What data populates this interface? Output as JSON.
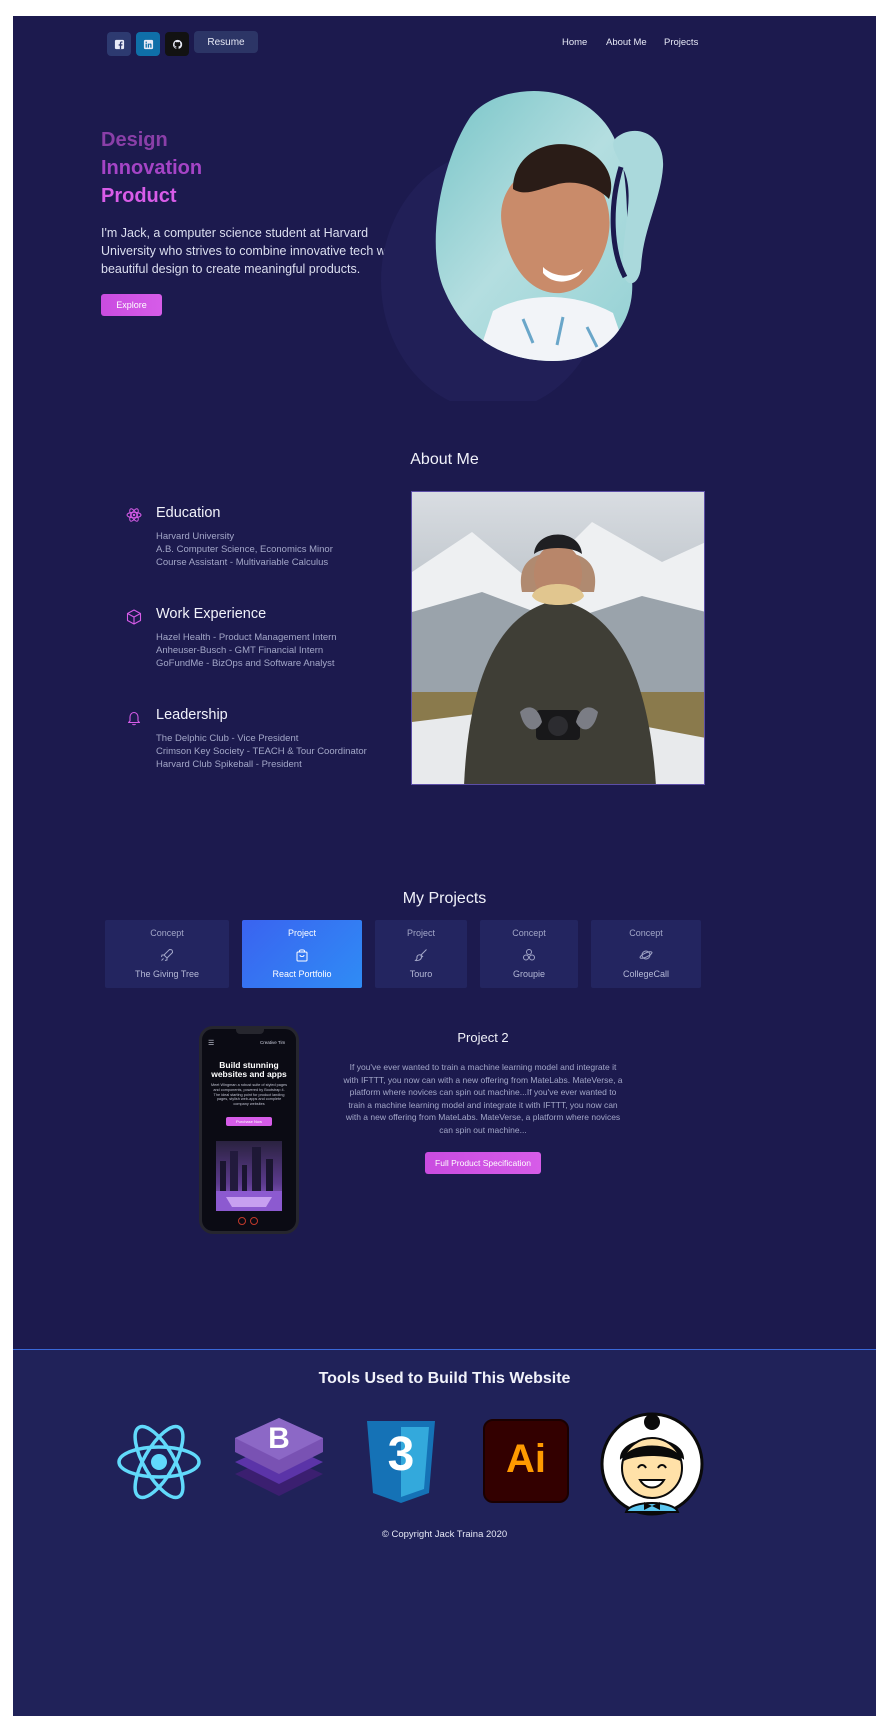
{
  "nav": {
    "resume_label": "Resume",
    "links": [
      "Home",
      "About Me",
      "Projects"
    ],
    "socials": [
      "facebook-icon",
      "linkedin-icon",
      "github-icon"
    ]
  },
  "hero": {
    "words": [
      "Design",
      "Innovation",
      "Product"
    ],
    "intro": "I'm Jack, a computer science student at Harvard University who strives to combine innovative tech with beautiful design to create meaningful products.",
    "explore_label": "Explore"
  },
  "about": {
    "title": "About Me",
    "sections": [
      {
        "icon": "atom-icon",
        "heading": "Education",
        "lines": [
          "Harvard University",
          "A.B. Computer Science, Economics Minor",
          "Course Assistant - Multivariable Calculus"
        ]
      },
      {
        "icon": "cube-icon",
        "heading": "Work Experience",
        "lines": [
          "Hazel Health - Product Management Intern",
          "Anheuser-Busch - GMT Financial Intern",
          "GoFundMe - BizOps and Software Analyst"
        ]
      },
      {
        "icon": "bell-icon",
        "heading": "Leadership",
        "lines": [
          "The Delphic Club - Vice President",
          "Crimson Key Society - TEACH & Tour Coordinator",
          "Harvard Club Spikeball - President"
        ]
      }
    ]
  },
  "projects": {
    "title": "My Projects",
    "cards": [
      {
        "type": "Concept",
        "name": "The Giving Tree",
        "icon": "rocket-icon",
        "active": false
      },
      {
        "type": "Project",
        "name": "React Portfolio",
        "icon": "bag-icon",
        "active": true
      },
      {
        "type": "Project",
        "name": "Touro",
        "icon": "brush-icon",
        "active": false
      },
      {
        "type": "Concept",
        "name": "Groupie",
        "icon": "circles-icon",
        "active": false
      },
      {
        "type": "Concept",
        "name": "CollegeCall",
        "icon": "planet-icon",
        "active": false
      }
    ],
    "detail": {
      "title": "Project 2",
      "description": "If you've ever wanted to train a machine learning model and integrate it with IFTTT, you now can with a new offering from MateLabs. MateVerse, a platform where novices can spin out machine...If you've ever wanted to train a machine learning model and integrate it with IFTTT, you now can with a new offering from MateLabs. MateVerse, a platform where novices can spin out machine...",
      "button_label": "Full Product Specification"
    },
    "phone": {
      "brand": "Creative Tim",
      "headline": "Build stunning websites and apps",
      "body": "Meet Wingman a robust suite of styled pages and components, powered by Bootstrap 4. The ideal starting point for product landing pages, stylish web-apps and complete company websites",
      "button": "Purchase Now"
    }
  },
  "footer": {
    "tools_title": "Tools Used to Build This Website",
    "tools": [
      {
        "icon": "react-icon",
        "label": ""
      },
      {
        "icon": "bootstrap-icon",
        "label": "B"
      },
      {
        "icon": "css3-icon",
        "label": "3"
      },
      {
        "icon": "illustrator-icon",
        "label": "Ai"
      },
      {
        "icon": "avatar-icon",
        "label": ""
      }
    ],
    "copyright": "© Copyright Jack Traina 2020"
  },
  "colors": {
    "background": "#1c1a4e",
    "accent_pink": "#d65ce8",
    "accent_blue": "#2f7ff5"
  }
}
